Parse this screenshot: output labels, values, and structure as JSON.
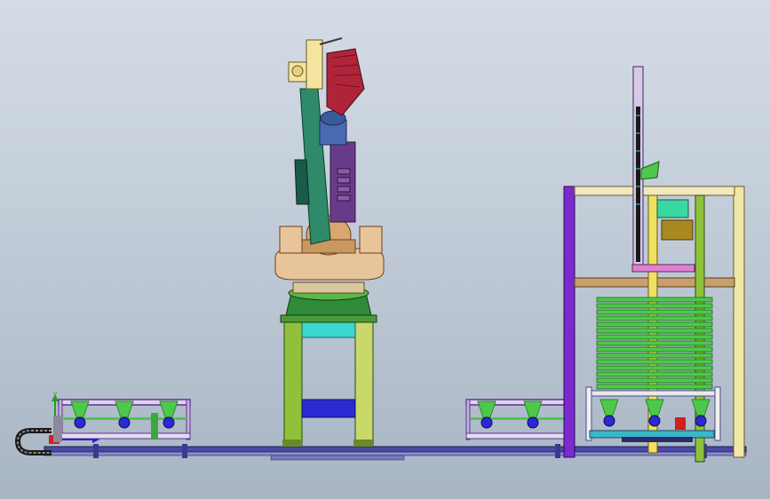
{
  "viewport": {
    "description_visible": false
  },
  "colors": {
    "background_top": "#d4dde6",
    "background_bottom": "#a8b5c4",
    "rail": "#4a4aa0",
    "rail_light": "#8a8ad0",
    "robot_base": "#2f8a3a",
    "robot_body_tan": "#e8c49a",
    "robot_arm_teal": "#2f8a6a",
    "robot_head_red": "#b0243a",
    "robot_cream": "#f3e4a0",
    "robot_purple": "#6a3a8a",
    "pedestal_green": "#8fc23a",
    "pedestal_cyan": "#3ad8d0",
    "pedestal_blue": "#2a2ad0",
    "frame_purple": "#7a2acd",
    "frame_cream": "#f0e8a8",
    "frame_brown": "#c8a070",
    "stack_green": "#4ec84a",
    "lift_black": "#1a1a1a",
    "lift_yellow": "#e0c020",
    "axis_x": "#d02020",
    "axis_y": "#20a020",
    "axis_z": "#2020d0"
  },
  "icons": {
    "triad": "coordinate-triad-icon",
    "cable_chain": "cable-chain-icon"
  }
}
